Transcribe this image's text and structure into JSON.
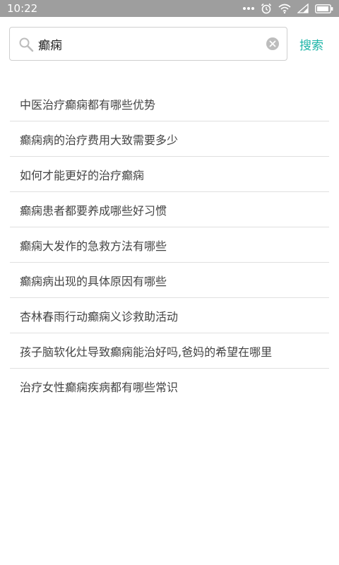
{
  "status_bar": {
    "time": "10:22"
  },
  "search": {
    "query": "癫痫",
    "button_label": "搜索"
  },
  "suggestions": [
    "中医治疗癫痫都有哪些优势",
    "癫痫病的治疗费用大致需要多少",
    "如何才能更好的治疗癫痫",
    "癫痫患者都要养成哪些好习惯",
    "癫痫大发作的急救方法有哪些",
    "癫痫病出现的具体原因有哪些",
    "杏林春雨行动癫痫义诊救助活动",
    "孩子脑软化灶导致癫痫能治好吗,爸妈的希望在哪里",
    "治疗女性癫痫疾病都有哪些常识"
  ],
  "colors": {
    "status_bar": "#9e9e9e",
    "accent": "#1fb5a8",
    "divider": "#e0e0e0",
    "text": "#444444"
  },
  "icons": {
    "search": "search-icon",
    "clear": "clear-icon",
    "alarm": "alarm-icon",
    "wifi": "wifi-icon",
    "signal": "signal-icon",
    "battery": "battery-icon"
  }
}
